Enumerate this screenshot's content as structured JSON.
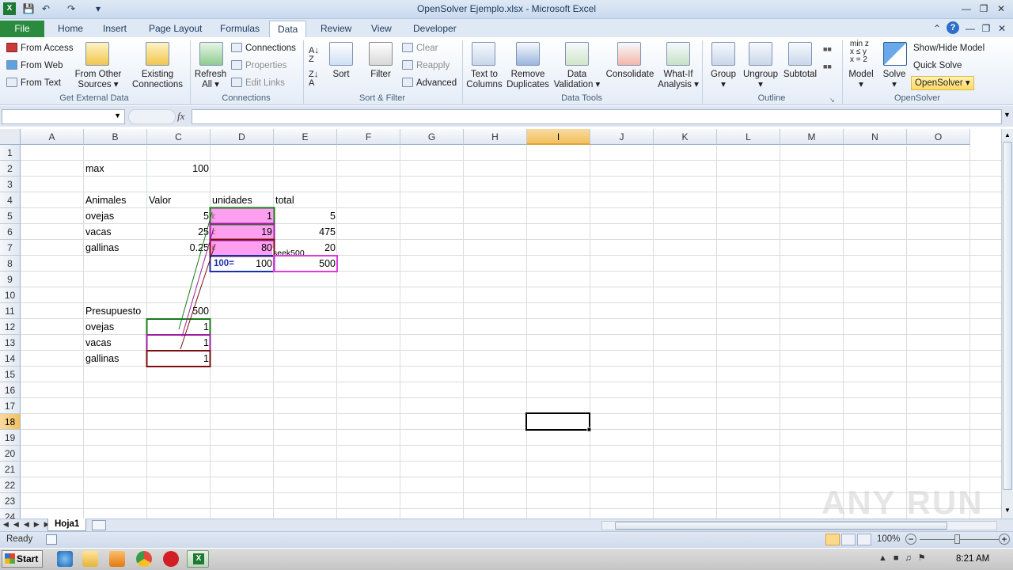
{
  "window": {
    "title": "OpenSolver Ejemplo.xlsx - Microsoft Excel"
  },
  "tabs": [
    "File",
    "Home",
    "Insert",
    "Page Layout",
    "Formulas",
    "Data",
    "Review",
    "View",
    "Developer"
  ],
  "ribbon": {
    "get_external": {
      "label": "Get External Data",
      "from_access": "From Access",
      "from_web": "From Web",
      "from_text": "From Text",
      "from_other_1": "From Other",
      "from_other_2": "Sources",
      "existing_1": "Existing",
      "existing_2": "Connections"
    },
    "connections": {
      "label": "Connections",
      "refresh_1": "Refresh",
      "refresh_2": "All",
      "connections": "Connections",
      "properties": "Properties",
      "edit_links": "Edit Links"
    },
    "sort_filter": {
      "label": "Sort & Filter",
      "sort": "Sort",
      "filter": "Filter",
      "clear": "Clear",
      "reapply": "Reapply",
      "advanced": "Advanced"
    },
    "data_tools": {
      "label": "Data Tools",
      "text_to_1": "Text to",
      "text_to_2": "Columns",
      "remove_1": "Remove",
      "remove_2": "Duplicates",
      "validation_1": "Data",
      "validation_2": "Validation",
      "consolidate": "Consolidate",
      "whatif_1": "What-If",
      "whatif_2": "Analysis"
    },
    "outline": {
      "label": "Outline",
      "group": "Group",
      "ungroup": "Ungroup",
      "subtotal": "Subtotal"
    },
    "opensolver": {
      "label": "OpenSolver",
      "model": "Model",
      "solve": "Solve",
      "show_hide": "Show/Hide Model",
      "quick_solve": "Quick Solve",
      "opensolver": "OpenSolver",
      "model_icon_1": "min z",
      "model_icon_2": "x ≤ y",
      "model_icon_3": "x = 2"
    }
  },
  "formula_bar": {
    "fx": "fx"
  },
  "columns": [
    "A",
    "B",
    "C",
    "D",
    "E",
    "F",
    "G",
    "H",
    "I",
    "J",
    "K",
    "L",
    "M",
    "N",
    "O"
  ],
  "rows": [
    "1",
    "2",
    "3",
    "4",
    "5",
    "6",
    "7",
    "8",
    "9",
    "10",
    "11",
    "12",
    "13",
    "14",
    "15",
    "16",
    "17",
    "18",
    "19",
    "20",
    "21",
    "22",
    "23",
    "24"
  ],
  "cells": {
    "b2": "max",
    "c2": "100",
    "b4": "Animales",
    "c4": "Valor",
    "d4": "unidades",
    "e4": "total",
    "b5": "ovejas",
    "c5": "5",
    "d5": "1",
    "e5": "5",
    "b6": "vacas",
    "c6": "25",
    "d6": "19",
    "e6": "475",
    "b7": "gallinas",
    "c7": "0.25",
    "d7": "80",
    "e7": "20",
    "d8_label": "100=",
    "d8": "100",
    "e8": "500",
    "seek_label": "seek500",
    "b11": "Presupuesto",
    "c11": "500",
    "b12": "ovejas",
    "c12": "1",
    "b13": "vacas",
    "c13": "1",
    "b14": "gallinas",
    "c14": "1"
  },
  "sheet_tabs": [
    "Hoja1"
  ],
  "status": {
    "ready": "Ready",
    "zoom": "100%"
  },
  "taskbar": {
    "start": "Start",
    "time": "8:21 AM"
  },
  "watermark": "ANY RUN"
}
